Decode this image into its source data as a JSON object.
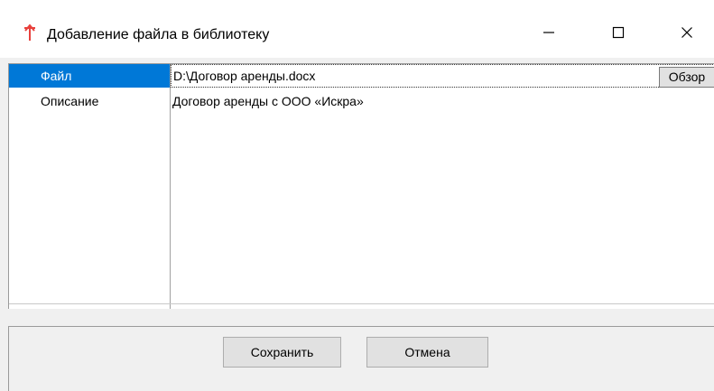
{
  "window": {
    "title": "Добавление файла в библиотеку",
    "icon": "red-up-arrow-icon"
  },
  "title_buttons": {
    "minimize": "minimize-icon",
    "maximize": "maximize-icon",
    "close": "close-icon"
  },
  "properties": [
    {
      "label": "Файл",
      "value": "D:\\Договор аренды.docx",
      "selected": true
    },
    {
      "label": "Описание",
      "value": "Договор аренды с ООО «Искра»",
      "selected": false
    }
  ],
  "browse_label": "Обзор",
  "footer": {
    "save_label": "Сохранить",
    "cancel_label": "Отмена"
  },
  "colors": {
    "selection": "#0078d7",
    "icon_red": "#e8413c"
  }
}
